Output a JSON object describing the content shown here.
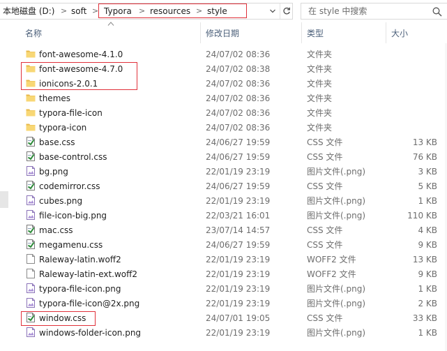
{
  "address": {
    "crumbs": [
      "本地磁盘 (D:)",
      "soft",
      "Typora",
      "resources",
      "style"
    ],
    "separator": ">"
  },
  "search": {
    "placeholder": "在 style 中搜索"
  },
  "columns": {
    "name": "名称",
    "modified": "修改日期",
    "type": "类型",
    "size": "大小"
  },
  "colors": {
    "highlight": "#e0303a",
    "folder": "#f8d775",
    "header_text": "#4c607a"
  },
  "files": [
    {
      "name": "font-awesome-4.1.0",
      "date": "24/07/02 08:36",
      "type": "文件夹",
      "size": "",
      "icon": "folder-icon"
    },
    {
      "name": "font-awesome-4.7.0",
      "date": "24/07/02 08:38",
      "type": "文件夹",
      "size": "",
      "icon": "folder-icon"
    },
    {
      "name": "ionicons-2.0.1",
      "date": "24/07/02 08:36",
      "type": "文件夹",
      "size": "",
      "icon": "folder-icon"
    },
    {
      "name": "themes",
      "date": "24/07/02 08:36",
      "type": "文件夹",
      "size": "",
      "icon": "folder-icon"
    },
    {
      "name": "typora-file-icon",
      "date": "24/07/02 08:36",
      "type": "文件夹",
      "size": "",
      "icon": "folder-icon"
    },
    {
      "name": "typora-icon",
      "date": "24/07/02 08:36",
      "type": "文件夹",
      "size": "",
      "icon": "folder-icon"
    },
    {
      "name": "base.css",
      "date": "24/06/27 19:59",
      "type": "CSS 文件",
      "size": "13 KB",
      "icon": "css-file-icon"
    },
    {
      "name": "base-control.css",
      "date": "24/06/27 19:59",
      "type": "CSS 文件",
      "size": "76 KB",
      "icon": "css-file-icon"
    },
    {
      "name": "bg.png",
      "date": "22/01/19 23:19",
      "type": "图片文件(.png)",
      "size": "3 KB",
      "icon": "image-file-icon"
    },
    {
      "name": "codemirror.css",
      "date": "24/06/27 19:59",
      "type": "CSS 文件",
      "size": "5 KB",
      "icon": "css-file-icon"
    },
    {
      "name": "cubes.png",
      "date": "22/01/19 23:19",
      "type": "图片文件(.png)",
      "size": "1 KB",
      "icon": "image-file-icon"
    },
    {
      "name": "file-icon-big.png",
      "date": "22/03/21 16:01",
      "type": "图片文件(.png)",
      "size": "110 KB",
      "icon": "image-file-icon"
    },
    {
      "name": "mac.css",
      "date": "23/07/14 14:57",
      "type": "CSS 文件",
      "size": "4 KB",
      "icon": "css-file-icon"
    },
    {
      "name": "megamenu.css",
      "date": "24/06/27 19:59",
      "type": "CSS 文件",
      "size": "9 KB",
      "icon": "css-file-icon"
    },
    {
      "name": "Raleway-latin.woff2",
      "date": "22/01/19 23:19",
      "type": "WOFF2 文件",
      "size": "13 KB",
      "icon": "blank-file-icon"
    },
    {
      "name": "Raleway-latin-ext.woff2",
      "date": "22/01/19 23:19",
      "type": "WOFF2 文件",
      "size": "9 KB",
      "icon": "blank-file-icon"
    },
    {
      "name": "typora-file-icon.png",
      "date": "22/01/19 23:19",
      "type": "图片文件(.png)",
      "size": "1 KB",
      "icon": "image-file-icon"
    },
    {
      "name": "typora-file-icon@2x.png",
      "date": "22/01/19 23:19",
      "type": "图片文件(.png)",
      "size": "2 KB",
      "icon": "image-file-icon"
    },
    {
      "name": "window.css",
      "date": "24/07/01 19:05",
      "type": "CSS 文件",
      "size": "33 KB",
      "icon": "css-file-icon"
    },
    {
      "name": "windows-folder-icon.png",
      "date": "22/01/19 23:19",
      "type": "图片文件(.png)",
      "size": "1 KB",
      "icon": "image-file-icon"
    }
  ]
}
